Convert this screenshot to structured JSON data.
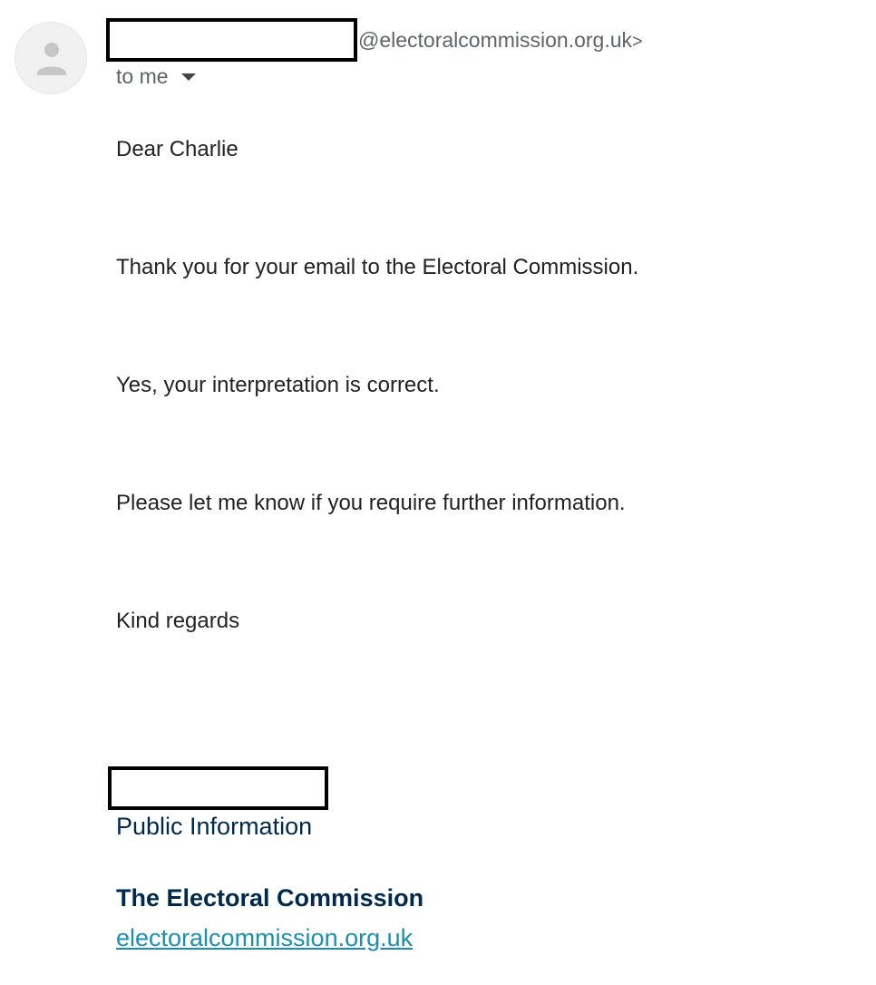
{
  "header": {
    "sender_domain": "@electoralcommission.org.uk",
    "sender_close": ">",
    "recipient_label": "to me",
    "avatar_icon": "person-icon",
    "caret_icon": "caret-down-icon"
  },
  "body": {
    "paragraphs": [
      "Dear Charlie",
      "Thank you for your email to the Electoral Commission.",
      "Yes, your interpretation is correct.",
      "Please let me know if you require further information.",
      "Kind regards"
    ]
  },
  "signature": {
    "role": "Public Information",
    "organisation": "The Electoral Commission",
    "website": "electoralcommission.org.uk"
  },
  "colors": {
    "signature_text": "#002a4d",
    "link": "#1a8fb4",
    "muted": "#5f6368"
  }
}
